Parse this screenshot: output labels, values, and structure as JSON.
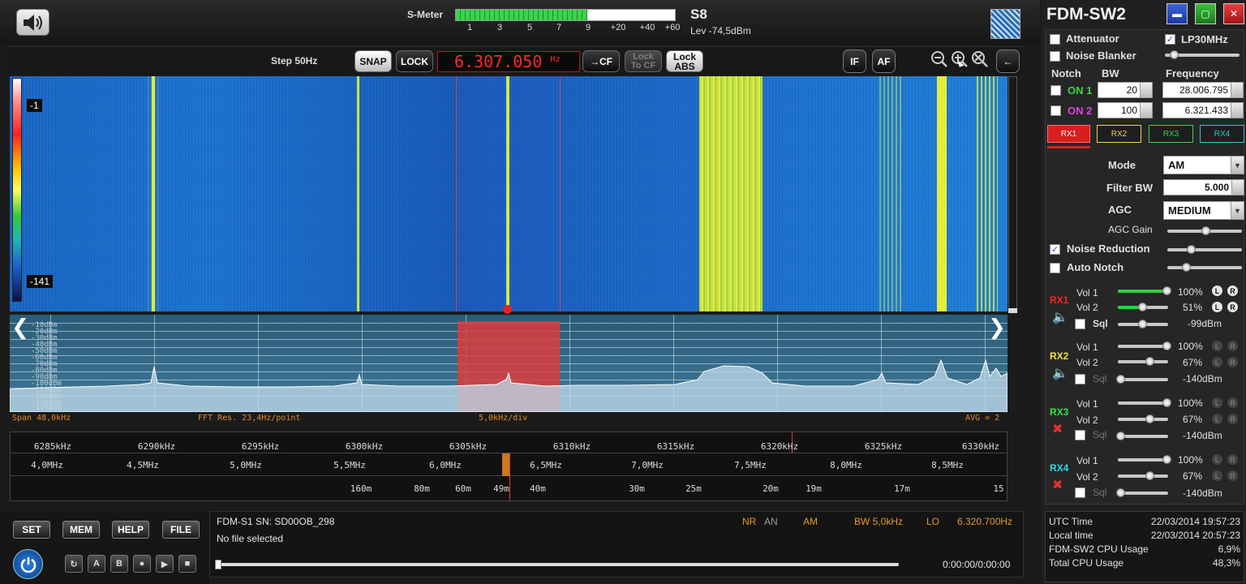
{
  "header": {
    "smeter_label": "S-Meter",
    "smeter_ticks": [
      "1",
      "3",
      "5",
      "7",
      "9",
      "+20",
      "+40",
      "+60"
    ],
    "smeter_level_fraction": 0.6,
    "s_reading": "S8",
    "level_reading": "Lev -74,5dBm"
  },
  "controls": {
    "step": "Step 50Hz",
    "snap": "SNAP",
    "lock": "LOCK",
    "frequency": "6.307.050",
    "frequency_unit": "Hz",
    "to_cf": "→CF",
    "lock_to_cf_line1": "Lock",
    "lock_to_cf_line2": "To CF",
    "lock_abs_line1": "Lock",
    "lock_abs_line2": "ABS",
    "if_button": "IF",
    "af_button": "AF"
  },
  "waterfall": {
    "scale_top": "-1",
    "scale_bottom": "-141"
  },
  "spectrum": {
    "db_labels": [
      "-10dBm",
      "-20dBm",
      "-30dBm",
      "-40dBm",
      "-50dBm",
      "-60dBm",
      "-70dBm",
      "-80dBm",
      "-90dBm",
      "-100dBm",
      "-110dBm",
      "-120dBm",
      "-130dBm",
      "-140dBm"
    ],
    "span": "Span 48,0kHz",
    "fft_res": "FFT Res. 23,4Hz/point",
    "div": "5,0kHz/div",
    "avg": "AVG = 2"
  },
  "freq_scale": {
    "khz_labels": [
      "6285kHz",
      "6290kHz",
      "6295kHz",
      "6300kHz",
      "6305kHz",
      "6310kHz",
      "6315kHz",
      "6320kHz",
      "6325kHz",
      "6330kHz"
    ],
    "mhz_labels": [
      "4,0MHz",
      "4,5MHz",
      "5,0MHz",
      "5,5MHz",
      "6,0MHz",
      "6,5MHz",
      "7,0MHz",
      "7,5MHz",
      "8,0MHz",
      "8,5MHz"
    ],
    "band_labels": [
      "160m",
      "80m",
      "60m",
      "49m",
      "40m",
      "30m",
      "25m",
      "20m",
      "19m",
      "17m",
      "15"
    ]
  },
  "bottom": {
    "set": "SET",
    "mem": "MEM",
    "help": "HELP",
    "file": "FILE",
    "transport": [
      "A",
      "B"
    ],
    "device": "FDM-S1 SN: SD00OB_298",
    "file_status": "No file selected",
    "nr": "NR",
    "an": "AN",
    "mode": "AM",
    "bw": "BW 5,0kHz",
    "lo_label": "LO",
    "lo_value": "6.320.700Hz",
    "time": "0:00:00/0:00:00"
  },
  "panel": {
    "title": "FDM-SW2",
    "attenuator": "Attenuator",
    "lp30": "LP30MHz",
    "noise_blanker": "Noise Blanker",
    "notch": "Notch",
    "bw": "BW",
    "frequency": "Frequency",
    "on1": "ON 1",
    "on1_bw": "20",
    "on1_freq": "28.006.795",
    "on2": "ON 2",
    "on2_bw": "100",
    "on2_freq": "6.321.433",
    "rx_tabs": [
      "RX1",
      "RX2",
      "RX3",
      "RX4"
    ],
    "mode_label": "Mode",
    "mode_value": "AM",
    "filter_label": "Filter BW",
    "filter_value": "5.000",
    "agc_label": "AGC",
    "agc_value": "MEDIUM",
    "agc_gain": "AGC Gain",
    "noise_reduction": "Noise Reduction",
    "auto_notch": "Auto Notch",
    "vol1": "Vol 1",
    "vol2": "Vol 2",
    "sql": "Sql",
    "rx1": {
      "name": "RX1",
      "vol1": "100%",
      "vol2": "51%",
      "sql": "-99dBm"
    },
    "rx2": {
      "name": "RX2",
      "vol1": "100%",
      "vol2": "67%",
      "sql": "-140dBm"
    },
    "rx3": {
      "name": "RX3",
      "vol1": "100%",
      "vol2": "67%",
      "sql": "-140dBm"
    },
    "rx4": {
      "name": "RX4",
      "vol1": "100%",
      "vol2": "67%",
      "sql": "-140dBm"
    },
    "lr_l": "L",
    "lr_r": "R"
  },
  "status": {
    "utc_label": "UTC Time",
    "utc_value": "22/03/2014 19:57:23",
    "local_label": "Local time",
    "local_value": "22/03/2014 20:57:23",
    "cpu_label": "FDM-SW2 CPU Usage",
    "cpu_value": "6,9%",
    "total_label": "Total CPU Usage",
    "total_value": "48,3%"
  },
  "colors": {
    "accent_red": "#ff2a2a",
    "passband": "#d83a3a",
    "rx1": "#ff2424",
    "rx2": "#f0e040",
    "rx3": "#39e04a",
    "rx4": "#30d8e0"
  }
}
